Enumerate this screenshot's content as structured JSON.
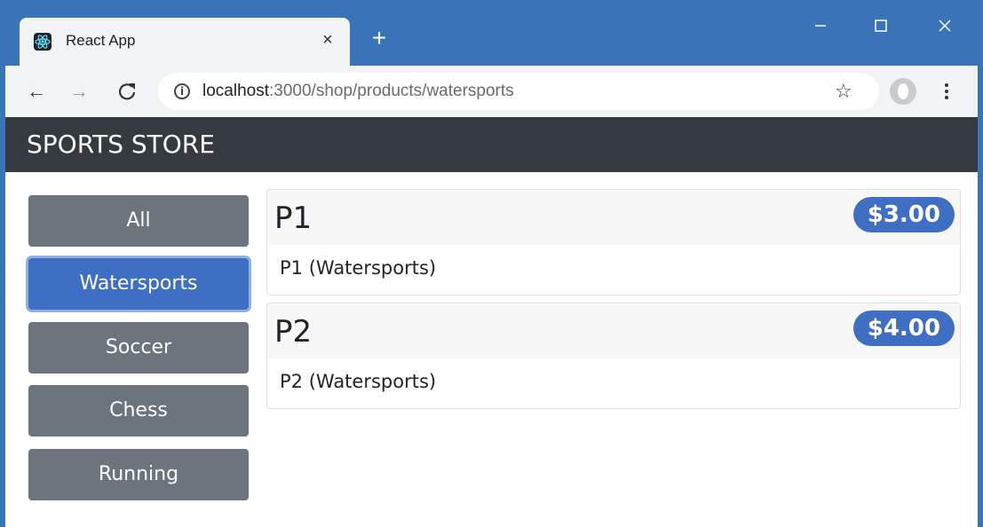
{
  "browser": {
    "tab_title": "React App",
    "tab_close": "×",
    "new_tab": "+",
    "url_host": "localhost",
    "url_path": ":3000/shop/products/watersports",
    "window_controls": {
      "minimize": "—",
      "maximize": "☐",
      "close": "✕"
    },
    "nav": {
      "back": "←",
      "forward": "→",
      "reload": "C"
    },
    "star": "☆",
    "info": "i"
  },
  "app": {
    "brand": "SPORTS STORE",
    "categories": [
      {
        "label": "All",
        "active": false
      },
      {
        "label": "Watersports",
        "active": true
      },
      {
        "label": "Soccer",
        "active": false
      },
      {
        "label": "Chess",
        "active": false
      },
      {
        "label": "Running",
        "active": false
      }
    ],
    "products": [
      {
        "name": "P1",
        "price": "$3.00",
        "description": "P1 (Watersports)"
      },
      {
        "name": "P2",
        "price": "$4.00",
        "description": "P2 (Watersports)"
      }
    ]
  },
  "colors": {
    "window_accent": "#3b73b9",
    "navbar_bg": "#343a40",
    "button_secondary": "#6c757d",
    "button_primary": "#3f6fc2"
  },
  "icons": [
    "react-favicon-icon",
    "close-tab-icon",
    "new-tab-icon",
    "back-arrow-icon",
    "forward-arrow-icon",
    "reload-icon",
    "info-icon",
    "star-icon",
    "profile-icon",
    "menu-icon"
  ]
}
